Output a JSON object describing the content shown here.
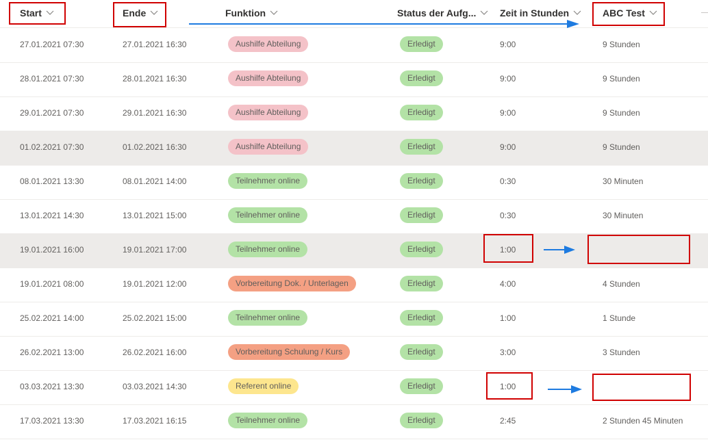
{
  "columns": [
    {
      "key": "start",
      "label": "Start"
    },
    {
      "key": "ende",
      "label": "Ende"
    },
    {
      "key": "funktion",
      "label": "Funktion"
    },
    {
      "key": "status",
      "label": "Status der Aufg..."
    },
    {
      "key": "zeit",
      "label": "Zeit in Stunden"
    },
    {
      "key": "abc",
      "label": "ABC Test"
    }
  ],
  "colors": {
    "aushilfe": "#f4c2c8",
    "teilnehmer": "#b3e2a6",
    "vorbereitung": "#f4a083",
    "referent": "#fde68e",
    "status": "#b3e2a6",
    "highlight": "#d00000",
    "arrow": "#1e7be0",
    "selected_row": "#edebe9"
  },
  "rows": [
    {
      "start": "27.01.2021 07:30",
      "ende": "27.01.2021 16:30",
      "funktion": "Aushilfe Abteilung",
      "funktion_color": "aushilfe",
      "status": "Erledigt",
      "zeit": "9:00",
      "abc": "9 Stunden",
      "selected": false
    },
    {
      "start": "28.01.2021 07:30",
      "ende": "28.01.2021 16:30",
      "funktion": "Aushilfe Abteilung",
      "funktion_color": "aushilfe",
      "status": "Erledigt",
      "zeit": "9:00",
      "abc": "9 Stunden",
      "selected": false
    },
    {
      "start": "29.01.2021 07:30",
      "ende": "29.01.2021 16:30",
      "funktion": "Aushilfe Abteilung",
      "funktion_color": "aushilfe",
      "status": "Erledigt",
      "zeit": "9:00",
      "abc": "9 Stunden",
      "selected": false
    },
    {
      "start": "01.02.2021 07:30",
      "ende": "01.02.2021 16:30",
      "funktion": "Aushilfe Abteilung",
      "funktion_color": "aushilfe",
      "status": "Erledigt",
      "zeit": "9:00",
      "abc": "9 Stunden",
      "selected": true
    },
    {
      "start": "08.01.2021 13:30",
      "ende": "08.01.2021 14:00",
      "funktion": "Teilnehmer online",
      "funktion_color": "teilnehmer",
      "status": "Erledigt",
      "zeit": "0:30",
      "abc": "30 Minuten",
      "selected": false
    },
    {
      "start": "13.01.2021 14:30",
      "ende": "13.01.2021 15:00",
      "funktion": "Teilnehmer online",
      "funktion_color": "teilnehmer",
      "status": "Erledigt",
      "zeit": "0:30",
      "abc": "30 Minuten",
      "selected": false
    },
    {
      "start": "19.01.2021 16:00",
      "ende": "19.01.2021 17:00",
      "funktion": "Teilnehmer online",
      "funktion_color": "teilnehmer",
      "status": "Erledigt",
      "zeit": "1:00",
      "abc": "",
      "selected": true
    },
    {
      "start": "19.01.2021 08:00",
      "ende": "19.01.2021 12:00",
      "funktion": "Vorbereitung Dok. / Unterlagen",
      "funktion_color": "vorbereitung",
      "status": "Erledigt",
      "zeit": "4:00",
      "abc": "4 Stunden",
      "selected": false
    },
    {
      "start": "25.02.2021 14:00",
      "ende": "25.02.2021 15:00",
      "funktion": "Teilnehmer online",
      "funktion_color": "teilnehmer",
      "status": "Erledigt",
      "zeit": "1:00",
      "abc": "1 Stunde",
      "selected": false
    },
    {
      "start": "26.02.2021 13:00",
      "ende": "26.02.2021 16:00",
      "funktion": "Vorbereitung Schulung / Kurs",
      "funktion_color": "vorbereitung",
      "status": "Erledigt",
      "zeit": "3:00",
      "abc": "3 Stunden",
      "selected": false
    },
    {
      "start": "03.03.2021 13:30",
      "ende": "03.03.2021 14:30",
      "funktion": "Referent online",
      "funktion_color": "referent",
      "status": "Erledigt",
      "zeit": "1:00",
      "abc": "",
      "selected": false
    },
    {
      "start": "17.03.2021 13:30",
      "ende": "17.03.2021 16:15",
      "funktion": "Teilnehmer online",
      "funktion_color": "teilnehmer",
      "status": "Erledigt",
      "zeit": "2:45",
      "abc": "2 Stunden 45 Minuten",
      "selected": false
    }
  ]
}
